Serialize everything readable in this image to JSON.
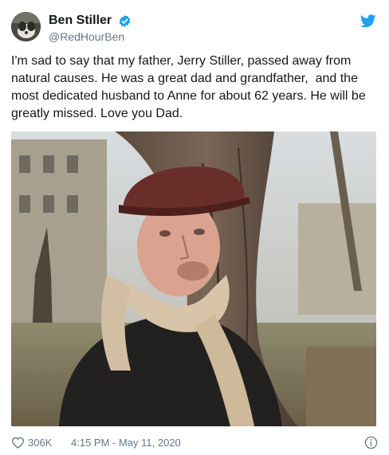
{
  "author": {
    "display_name": "Ben Stiller",
    "handle": "@RedHourBen",
    "verified": true,
    "avatar_icon": "profile-photo"
  },
  "tweet": {
    "text": "I'm sad to say that my father, Jerry Stiller, passed away from natural causes. He was a great dad and grandfather,  and the most dedicated husband to Anne for about 62 years. He will be greatly missed. Love you Dad."
  },
  "media": {
    "type": "photo",
    "description_icon": "elderly-man-by-tree-photo"
  },
  "footer": {
    "likes": "306K",
    "timestamp": "4:15 PM - May 11, 2020"
  },
  "colors": {
    "brand": "#1da1f2",
    "text": "#14171a",
    "muted": "#657786"
  }
}
